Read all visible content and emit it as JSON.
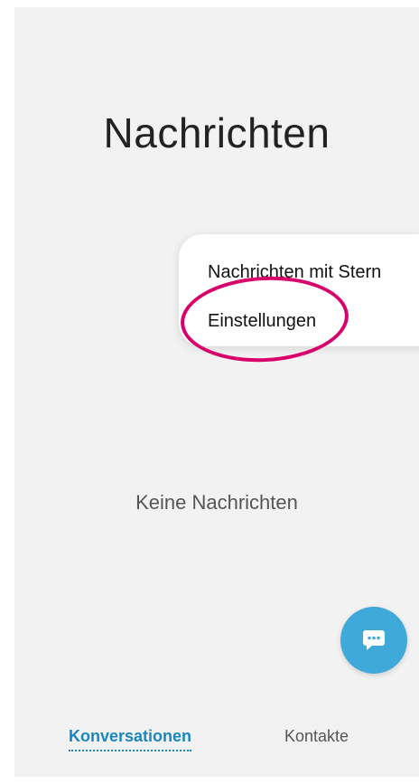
{
  "header": {
    "title": "Nachrichten"
  },
  "menu": {
    "items": [
      {
        "label": "Nachrichten mit Stern"
      },
      {
        "label": "Einstellungen"
      }
    ]
  },
  "main": {
    "empty_text": "Keine Nachrichten"
  },
  "fab": {
    "icon": "chat-bubble-icon",
    "color": "#3fa9d9"
  },
  "bottom_nav": {
    "tabs": [
      {
        "label": "Konversationen",
        "active": true
      },
      {
        "label": "Kontakte",
        "active": false
      }
    ]
  },
  "colors": {
    "accent": "#1a86bf",
    "highlight": "#d8006b",
    "background": "#f2f2f2"
  }
}
